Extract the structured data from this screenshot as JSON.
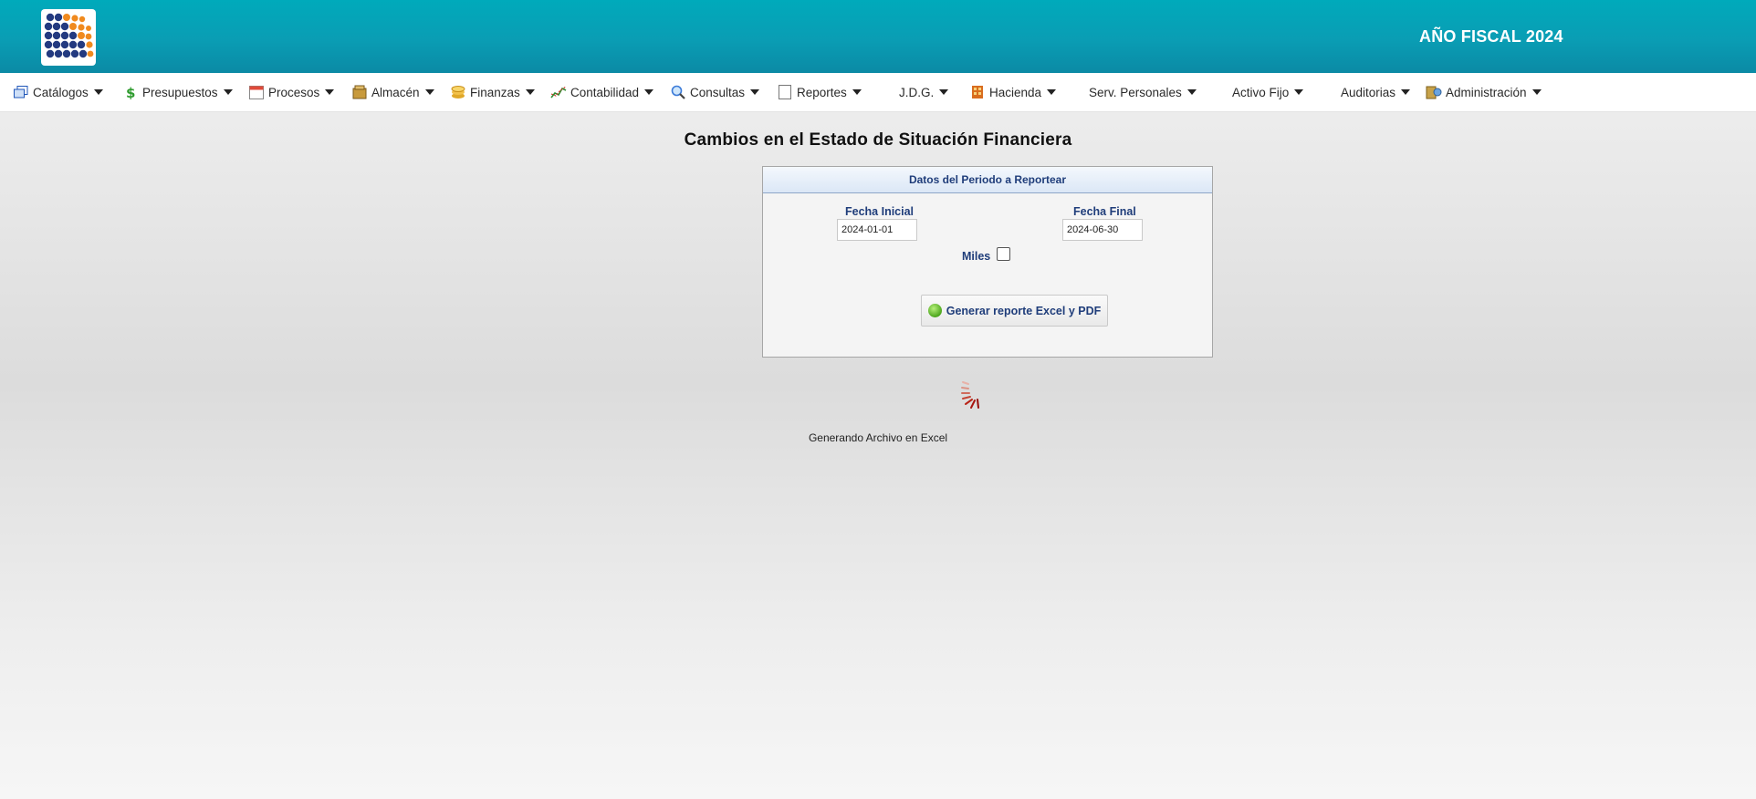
{
  "header": {
    "logo_icon": "grid-dots-logo-icon",
    "fiscal_label": "AÑO FISCAL  2024",
    "colors": {
      "bar_top": "#00aabb",
      "bar_bottom": "#0b8aa5"
    }
  },
  "menu": {
    "items": [
      {
        "label": "Catálogos",
        "icon": "windows-icon",
        "has_caret": true
      },
      {
        "label": "Presupuestos",
        "icon": "money-icon",
        "has_caret": true
      },
      {
        "label": "Procesos",
        "icon": "calendar-icon",
        "has_caret": true
      },
      {
        "label": "Almacén",
        "icon": "box-icon",
        "has_caret": true
      },
      {
        "label": "Finanzas",
        "icon": "coins-icon",
        "has_caret": true
      },
      {
        "label": "Contabilidad",
        "icon": "chart-icon",
        "has_caret": true
      },
      {
        "label": "Consultas",
        "icon": "magnifier-icon",
        "has_caret": true
      },
      {
        "label": "Reportes",
        "icon": "document-icon",
        "has_caret": true
      },
      {
        "label": "J.D.G.",
        "icon": "",
        "has_caret": true
      },
      {
        "label": "Hacienda",
        "icon": "building-icon",
        "has_caret": true
      },
      {
        "label": "Serv. Personales",
        "icon": "",
        "has_caret": true
      },
      {
        "label": "Activo Fijo",
        "icon": "",
        "has_caret": true
      },
      {
        "label": "Auditorias",
        "icon": "",
        "has_caret": true
      },
      {
        "label": "Administración",
        "icon": "admin-icon",
        "has_caret": true
      }
    ]
  },
  "page": {
    "title": "Cambios en el Estado de Situación Financiera",
    "panel": {
      "heading": "Datos del Periodo a Reportear",
      "fecha_inicial_label": "Fecha Inicial",
      "fecha_inicial_value": "2024-01-01",
      "fecha_final_label": "Fecha Final",
      "fecha_final_value": "2024-06-30",
      "miles_label": "Miles",
      "miles_checked": false,
      "generate_button_label": "Generar reporte Excel y PDF"
    },
    "status": {
      "spinner_icon": "loading-spinner-icon",
      "message": "Generando Archivo en Excel"
    }
  }
}
